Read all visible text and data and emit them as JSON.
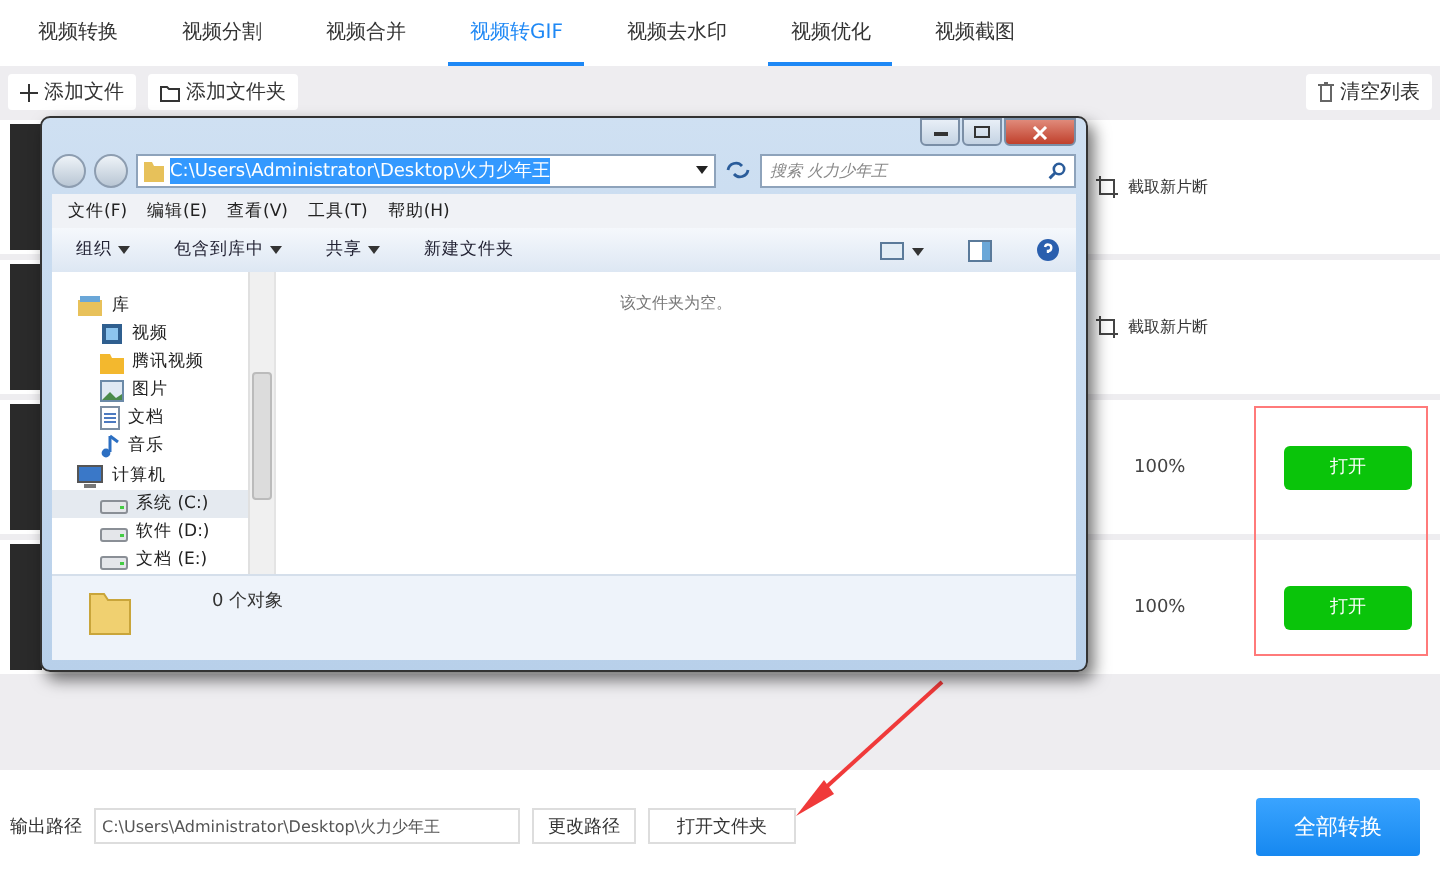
{
  "tabs": [
    {
      "label": "视频转换",
      "selected": false,
      "hovered": false
    },
    {
      "label": "视频分割",
      "selected": false,
      "hovered": false
    },
    {
      "label": "视频合并",
      "selected": false,
      "hovered": false
    },
    {
      "label": "视频转GIF",
      "selected": true,
      "hovered": false
    },
    {
      "label": "视频去水印",
      "selected": false,
      "hovered": false
    },
    {
      "label": "视频优化",
      "selected": false,
      "hovered": true
    },
    {
      "label": "视频截图",
      "selected": false,
      "hovered": false
    }
  ],
  "toolbar": {
    "add_file": "添加文件",
    "add_folder": "添加文件夹",
    "clear_list": "清空列表"
  },
  "rows": [
    {
      "kind": "clip",
      "action": "截取新片断"
    },
    {
      "kind": "clip",
      "action": "截取新片断"
    },
    {
      "kind": "done",
      "progress": "100%",
      "button": "打开"
    },
    {
      "kind": "done",
      "progress": "100%",
      "button": "打开"
    }
  ],
  "dialog": {
    "address": "C:\\Users\\Administrator\\Desktop\\火力少年王",
    "search_placeholder": "搜索 火力少年王",
    "menu": [
      "文件(F)",
      "编辑(E)",
      "查看(V)",
      "工具(T)",
      "帮助(H)"
    ],
    "commands": [
      {
        "label": "组织",
        "dropdown": true
      },
      {
        "label": "包含到库中",
        "dropdown": true
      },
      {
        "label": "共享",
        "dropdown": true
      },
      {
        "label": "新建文件夹",
        "dropdown": false
      }
    ],
    "nav": [
      {
        "label": "库",
        "kind": "library",
        "selected": false,
        "children": [
          {
            "label": "视频",
            "kind": "video",
            "selected": false
          },
          {
            "label": "腾讯视频",
            "kind": "folder",
            "selected": false
          },
          {
            "label": "图片",
            "kind": "picture",
            "selected": false
          },
          {
            "label": "文档",
            "kind": "document",
            "selected": false
          },
          {
            "label": "音乐",
            "kind": "music",
            "selected": false
          }
        ]
      },
      {
        "label": "计算机",
        "kind": "computer",
        "selected": false,
        "children": [
          {
            "label": "系统 (C:)",
            "kind": "drive",
            "selected": true
          },
          {
            "label": "软件 (D:)",
            "kind": "drive",
            "selected": false
          },
          {
            "label": "文档 (E:)",
            "kind": "drive",
            "selected": false
          }
        ]
      }
    ],
    "empty_message": "该文件夹为空。",
    "status": "0 个对象"
  },
  "output": {
    "label": "输出路径",
    "path": "C:\\Users\\Administrator\\Desktop\\火力少年王",
    "change_button": "更改路径",
    "open_folder_button": "打开文件夹",
    "convert_all_button": "全部转换"
  }
}
